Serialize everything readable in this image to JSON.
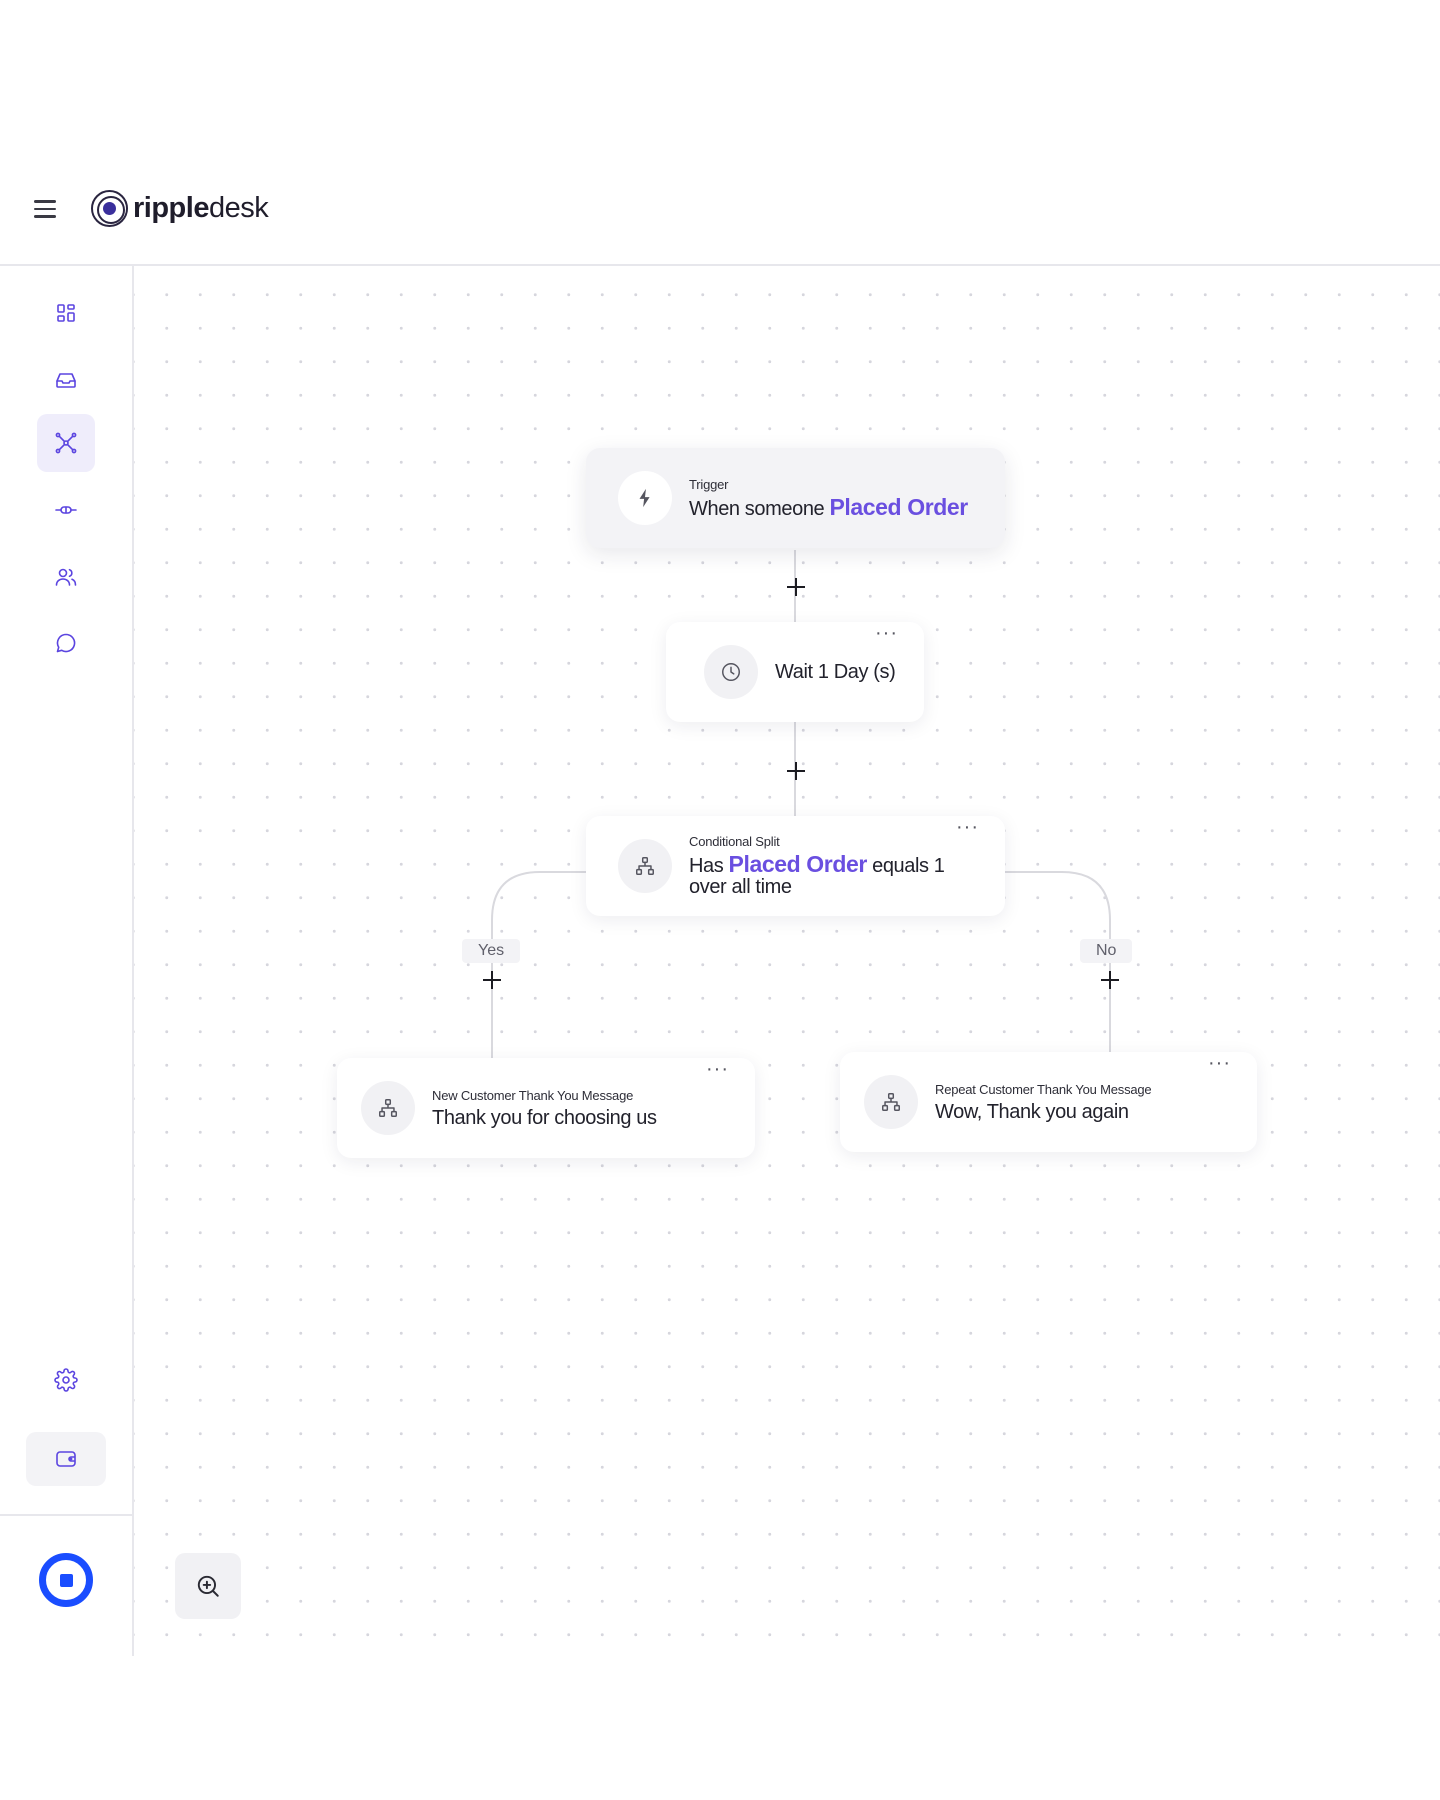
{
  "app": {
    "logo_bold": "ripple",
    "logo_light": "desk"
  },
  "sidebar": {
    "items": [
      {
        "name": "dashboard",
        "icon": "grid-icon",
        "active": false
      },
      {
        "name": "inbox",
        "icon": "inbox-icon",
        "active": false
      },
      {
        "name": "flows",
        "icon": "network-icon",
        "active": true
      },
      {
        "name": "integrations",
        "icon": "link-icon",
        "active": false
      },
      {
        "name": "contacts",
        "icon": "users-icon",
        "active": false
      },
      {
        "name": "messages",
        "icon": "chat-icon",
        "active": false
      }
    ],
    "bottom": [
      "gear-icon",
      "wallet-icon",
      "help-icon"
    ]
  },
  "flow": {
    "trigger": {
      "label": "Trigger",
      "prefix": "When someone",
      "event": "Placed Order"
    },
    "wait": {
      "title": "Wait 1 Day (s)"
    },
    "split": {
      "label": "Conditional Split",
      "prefix": "Has",
      "event": "Placed Order",
      "condition": "equals 1",
      "suffix": "over all time"
    },
    "branches": {
      "yes_label": "Yes",
      "no_label": "No"
    },
    "yes_node": {
      "label": "New Customer Thank You Message",
      "title": "Thank you for choosing us"
    },
    "no_node": {
      "label": "Repeat Customer Thank You Message",
      "title": "Wow, Thank you again"
    },
    "menu_glyph": "···"
  },
  "colors": {
    "accent": "#6a4fe0",
    "help": "#1a4dff"
  }
}
